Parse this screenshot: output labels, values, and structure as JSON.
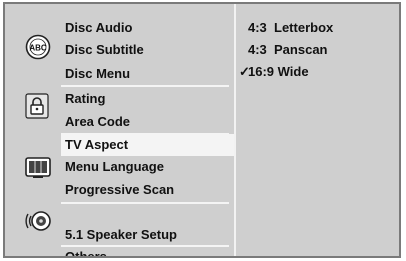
{
  "menu": {
    "groups": [
      {
        "icon": "disc-language-icon",
        "items": [
          "Disc Audio",
          "Disc Subtitle",
          "Disc Menu"
        ]
      },
      {
        "icon": "lock-icon",
        "items": [
          "Rating",
          "Area Code"
        ]
      },
      {
        "icon": "tv-display-icon",
        "items": [
          "TV Aspect",
          "Menu Language",
          "Progressive Scan"
        ]
      },
      {
        "icon": "speaker-icon",
        "items": [
          "",
          "5.1 Speaker Setup"
        ]
      },
      {
        "icon": "",
        "items": [
          "Others"
        ]
      }
    ],
    "selected": "TV Aspect"
  },
  "options": {
    "items": [
      {
        "label": "4:3  Letterbox",
        "checked": false
      },
      {
        "label": "4:3  Panscan",
        "checked": false
      },
      {
        "label": "16:9 Wide",
        "checked": true
      }
    ],
    "check_mark": "✓"
  }
}
